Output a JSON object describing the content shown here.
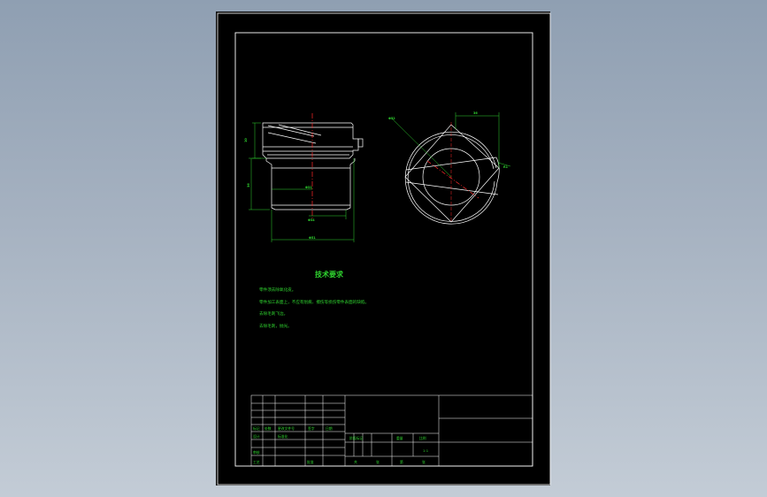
{
  "drawing": {
    "tech_req_title": "技术要求",
    "notes": [
      "零件须去除氧化皮。",
      "零件加工表面上，不应有划痕、擦伤等损伤零件表面的缺陷。",
      "去除毛刺飞边。",
      "去除毛刺，抛光。"
    ],
    "dims": {
      "height_top": "10",
      "height_body": "36",
      "dia_inner": "Φ31",
      "dia_bottom": "Φ34",
      "dia_overall": "Φ51",
      "flat_width": "36",
      "circle_dia": "Φ52",
      "radius": "R1"
    }
  },
  "title_block": {
    "rows": [
      {
        "c1": "标记",
        "c2": "处数",
        "c3": "更改文件号",
        "c4": "签字",
        "c5": "日期"
      },
      {
        "c1": "设计",
        "c2": "",
        "c3": "标准化",
        "c4": "",
        "c5": ""
      },
      {
        "c1": "审核",
        "c2": "",
        "c3": "",
        "c4": "",
        "c5": ""
      },
      {
        "c1": "工艺",
        "c2": "",
        "c3": "批准",
        "c4": "",
        "c5": ""
      }
    ],
    "stage_label": "阶段标记",
    "weight_label": "重量",
    "scale_label": "比例",
    "scale_value": "1:1",
    "sheet_total": "共",
    "sheet_unit": "张",
    "sheet_of": "第",
    "sheet_unit2": "张"
  },
  "colors": {
    "line": "#ffffff",
    "text": "#2fd42f",
    "center": "#ff2a2a",
    "background": "#000000"
  }
}
